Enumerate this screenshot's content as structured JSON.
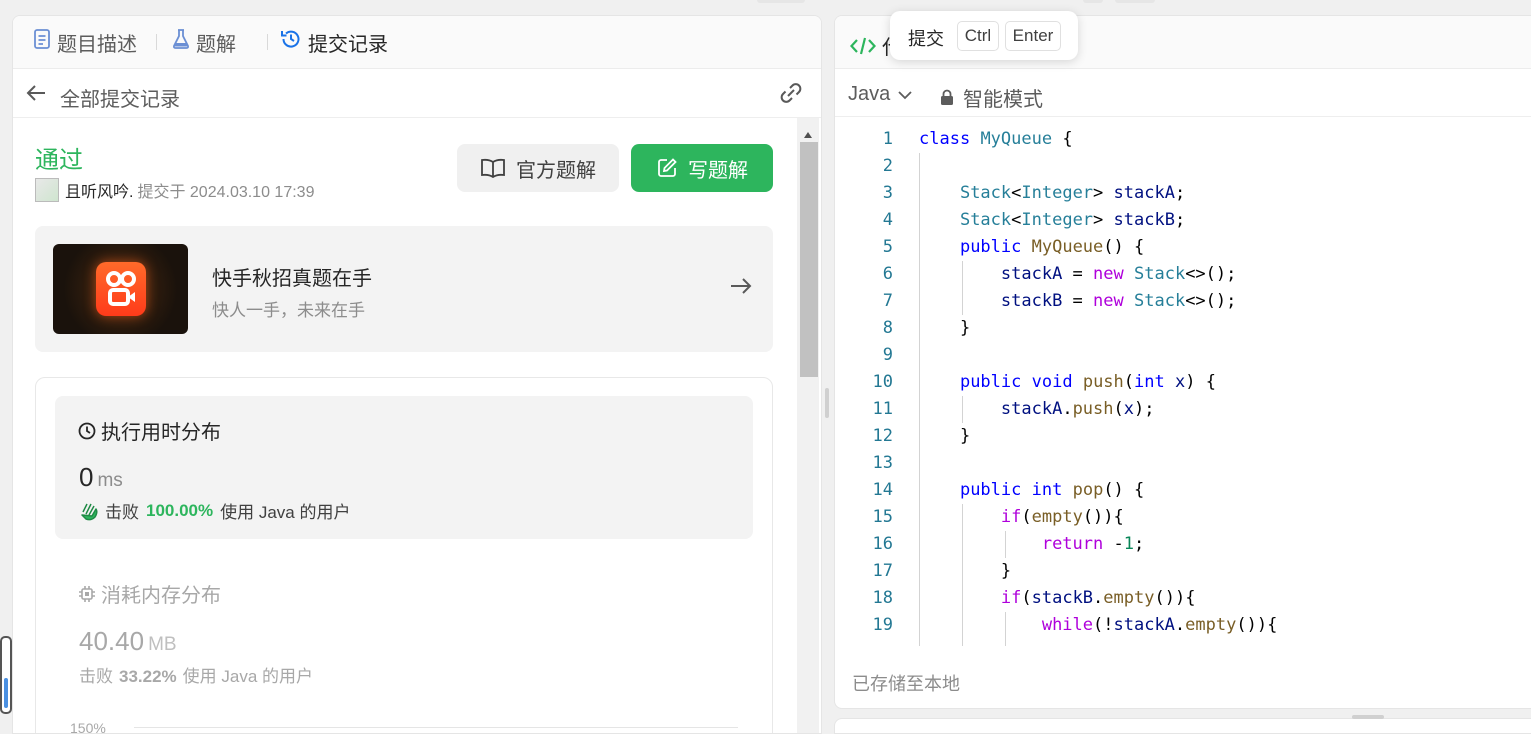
{
  "left_tabs": {
    "description": "题目描述",
    "solutions": "题解",
    "submissions": "提交记录"
  },
  "subheader": {
    "title": "全部提交记录"
  },
  "submission": {
    "status": "通过",
    "user": "且听风吟.",
    "submitted_at": "提交于 2024.03.10 17:39",
    "official_solution_label": "官方题解",
    "write_solution_label": "写题解"
  },
  "promo": {
    "title": "快手秋招真题在手",
    "subtitle": "快人一手，未来在手"
  },
  "runtime": {
    "title": "执行用时分布",
    "value": "0",
    "unit": "ms",
    "beat_label": "击败",
    "beat_pct": "100.00%",
    "beat_suffix": "使用 Java 的用户"
  },
  "memory": {
    "title": "消耗内存分布",
    "value": "40.40",
    "unit": "MB",
    "beat_label": "击败",
    "beat_pct": "33.22%",
    "beat_suffix": "使用 Java 的用户"
  },
  "chart": {
    "y_tick": "150%"
  },
  "editor": {
    "tab_label_partial": "代",
    "language": "Java",
    "mode": "智能模式",
    "saved_status": "已存储至本地"
  },
  "tooltip": {
    "label": "提交",
    "key1": "Ctrl",
    "key2": "Enter"
  },
  "colors": {
    "accent_green": "#2db55d",
    "tab_active_blue": "#1a73e8"
  }
}
